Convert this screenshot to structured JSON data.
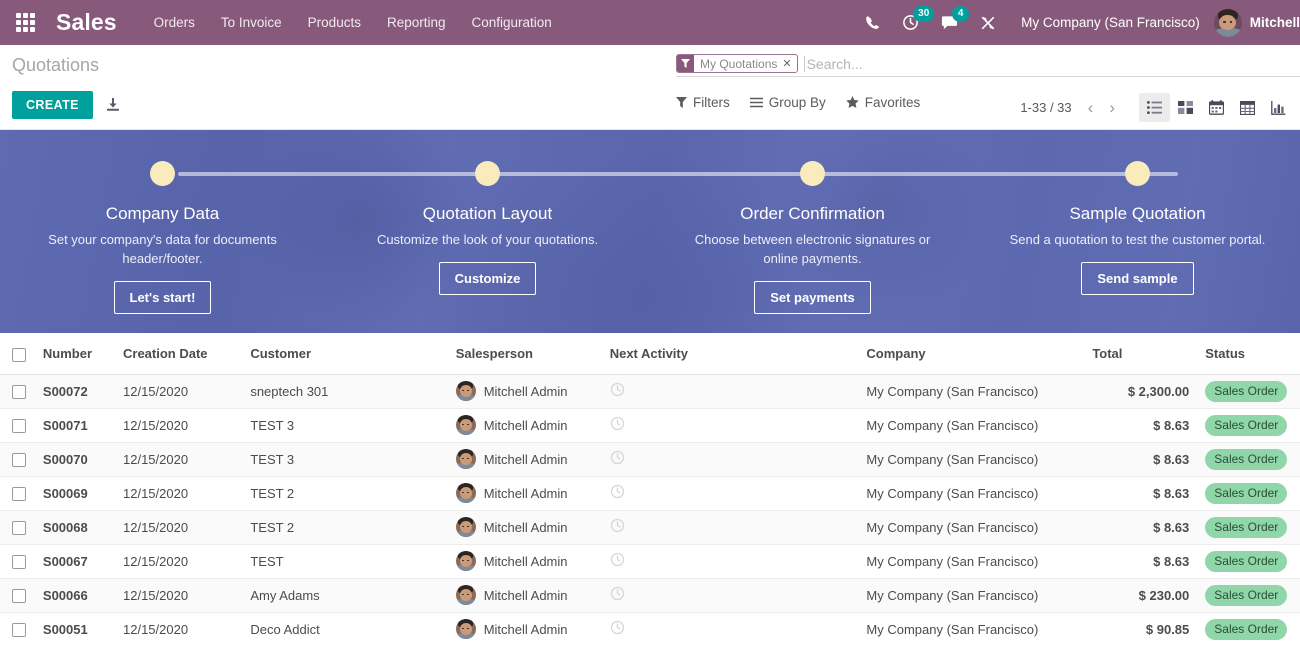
{
  "navbar": {
    "apps_icon": "apps-grid-icon",
    "brand": "Sales",
    "menu": [
      {
        "label": "Orders"
      },
      {
        "label": "To Invoice"
      },
      {
        "label": "Products"
      },
      {
        "label": "Reporting"
      },
      {
        "label": "Configuration"
      }
    ],
    "phone_icon": "phone-icon",
    "activity_icon": "clock-activity-icon",
    "activity_count": "30",
    "messaging_icon": "chat-bubble-icon",
    "messaging_count": "4",
    "debug_icon": "wrench-tools-icon",
    "company": "My Company (San Francisco)",
    "user": "Mitchell",
    "brand_color": "#875A7B",
    "badge_color": "#00A09D"
  },
  "control_panel": {
    "breadcrumb": "Quotations",
    "create_label": "CREATE",
    "import_icon": "import-download-icon",
    "search": {
      "facet_icon": "filter-funnel-icon",
      "facet_label": "My Quotations",
      "facet_close": "✕",
      "placeholder": "Search...",
      "value": ""
    },
    "filters": [
      {
        "label": "Filters",
        "icon": "filter-icon"
      },
      {
        "label": "Group By",
        "icon": "list-lines-icon"
      },
      {
        "label": "Favorites",
        "icon": "star-icon"
      }
    ],
    "pager": {
      "count": "1-33 / 33",
      "prev_icon": "chevron-left-icon",
      "next_icon": "chevron-right-icon"
    },
    "views": [
      {
        "name": "list",
        "icon": "list-view-icon",
        "active": true
      },
      {
        "name": "kanban",
        "icon": "kanban-view-icon",
        "active": false
      },
      {
        "name": "calendar",
        "icon": "calendar-view-icon",
        "active": false
      },
      {
        "name": "pivot",
        "icon": "pivot-view-icon",
        "active": false
      },
      {
        "name": "graph",
        "icon": "graph-view-icon",
        "active": false
      }
    ]
  },
  "banner": {
    "accent_dot_color": "#FAEBBD",
    "overlay_color": "#5664b8",
    "steps": [
      {
        "title": "Company Data",
        "desc": "Set your company's data for documents header/footer.",
        "button": "Let's start!"
      },
      {
        "title": "Quotation Layout",
        "desc": "Customize the look of your quotations.",
        "button": "Customize"
      },
      {
        "title": "Order Confirmation",
        "desc": "Choose between electronic signatures or online payments.",
        "button": "Set payments"
      },
      {
        "title": "Sample Quotation",
        "desc": "Send a quotation to test the customer portal.",
        "button": "Send sample"
      }
    ]
  },
  "table": {
    "columns": [
      "Number",
      "Creation Date",
      "Customer",
      "Salesperson",
      "Next Activity",
      "Company",
      "Total",
      "Status"
    ],
    "status_badge_color": "#8fd6a9",
    "rows": [
      {
        "number": "S00072",
        "date": "12/15/2020",
        "customer": "sneptech 301",
        "salesperson": "Mitchell Admin",
        "activity": "",
        "company": "My Company (San Francisco)",
        "total": "$ 2,300.00",
        "status": "Sales Order"
      },
      {
        "number": "S00071",
        "date": "12/15/2020",
        "customer": "TEST 3",
        "salesperson": "Mitchell Admin",
        "activity": "",
        "company": "My Company (San Francisco)",
        "total": "$ 8.63",
        "status": "Sales Order"
      },
      {
        "number": "S00070",
        "date": "12/15/2020",
        "customer": "TEST 3",
        "salesperson": "Mitchell Admin",
        "activity": "",
        "company": "My Company (San Francisco)",
        "total": "$ 8.63",
        "status": "Sales Order"
      },
      {
        "number": "S00069",
        "date": "12/15/2020",
        "customer": "TEST 2",
        "salesperson": "Mitchell Admin",
        "activity": "",
        "company": "My Company (San Francisco)",
        "total": "$ 8.63",
        "status": "Sales Order"
      },
      {
        "number": "S00068",
        "date": "12/15/2020",
        "customer": "TEST 2",
        "salesperson": "Mitchell Admin",
        "activity": "",
        "company": "My Company (San Francisco)",
        "total": "$ 8.63",
        "status": "Sales Order"
      },
      {
        "number": "S00067",
        "date": "12/15/2020",
        "customer": "TEST",
        "salesperson": "Mitchell Admin",
        "activity": "",
        "company": "My Company (San Francisco)",
        "total": "$ 8.63",
        "status": "Sales Order"
      },
      {
        "number": "S00066",
        "date": "12/15/2020",
        "customer": "Amy Adams",
        "salesperson": "Mitchell Admin",
        "activity": "",
        "company": "My Company (San Francisco)",
        "total": "$ 230.00",
        "status": "Sales Order"
      },
      {
        "number": "S00051",
        "date": "12/15/2020",
        "customer": "Deco Addict",
        "salesperson": "Mitchell Admin",
        "activity": "",
        "company": "My Company (San Francisco)",
        "total": "$ 90.85",
        "status": "Sales Order"
      }
    ]
  }
}
